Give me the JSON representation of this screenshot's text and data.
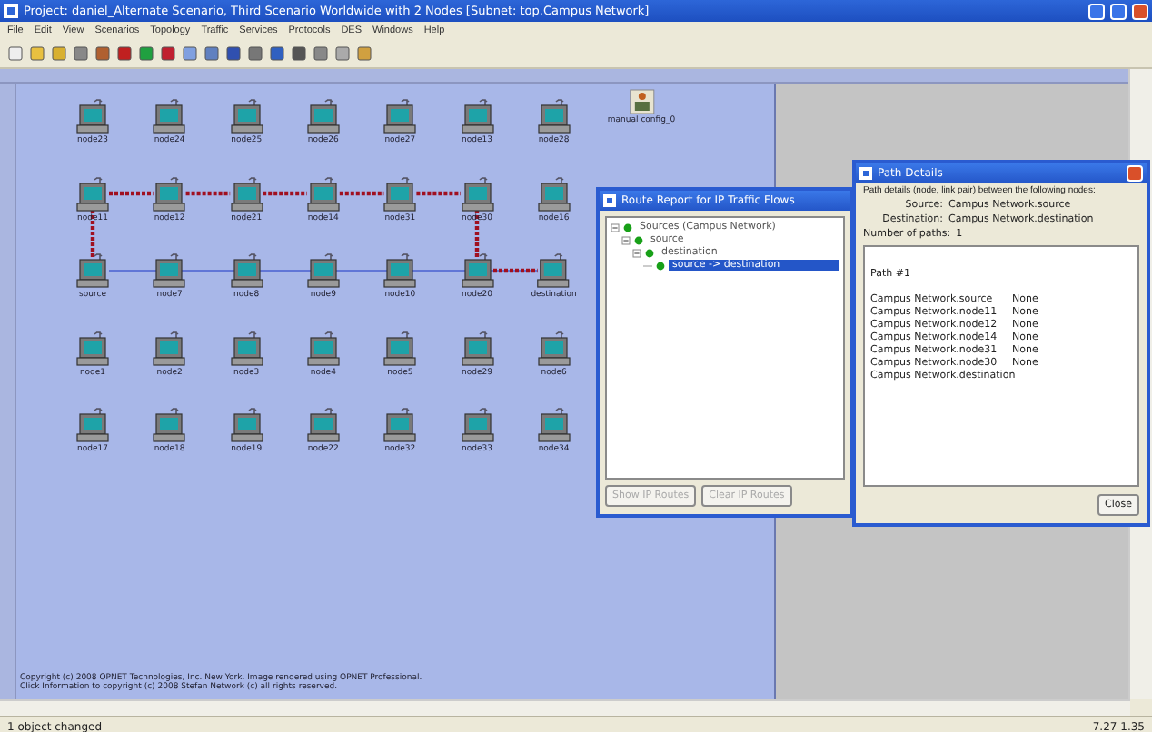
{
  "window": {
    "title": "Project: daniel_Alternate Scenario, Third Scenario Worldwide with 2 Nodes  [Subnet: top.Campus Network]"
  },
  "menu": [
    "File",
    "Edit",
    "View",
    "Scenarios",
    "Topology",
    "Traffic",
    "Services",
    "Protocols",
    "DES",
    "Windows",
    "Help"
  ],
  "canvas": {
    "config_object": {
      "label": "manual config_0"
    },
    "rows": [
      [
        {
          "label": "node23",
          "kind": "node",
          "on_route": false
        },
        {
          "label": "node24",
          "kind": "node",
          "on_route": false
        },
        {
          "label": "node25",
          "kind": "node",
          "on_route": false
        },
        {
          "label": "node26",
          "kind": "node",
          "on_route": false
        },
        {
          "label": "node27",
          "kind": "node",
          "on_route": false
        },
        {
          "label": "node13",
          "kind": "node",
          "on_route": false
        },
        {
          "label": "node28",
          "kind": "node",
          "on_route": false
        }
      ],
      [
        {
          "label": "node11",
          "kind": "node",
          "on_route": true
        },
        {
          "label": "node12",
          "kind": "node",
          "on_route": true
        },
        {
          "label": "node21",
          "kind": "node",
          "on_route": true
        },
        {
          "label": "node14",
          "kind": "node",
          "on_route": true
        },
        {
          "label": "node31",
          "kind": "node",
          "on_route": true
        },
        {
          "label": "node30",
          "kind": "node",
          "on_route": true
        },
        {
          "label": "node16",
          "kind": "node",
          "on_route": false
        }
      ],
      [
        {
          "label": "source",
          "kind": "source",
          "on_route": true
        },
        {
          "label": "node7",
          "kind": "node",
          "on_route": false
        },
        {
          "label": "node8",
          "kind": "node",
          "on_route": false
        },
        {
          "label": "node9",
          "kind": "node",
          "on_route": false
        },
        {
          "label": "node10",
          "kind": "node",
          "on_route": false
        },
        {
          "label": "node20",
          "kind": "node",
          "on_route": true
        },
        {
          "label": "destination",
          "kind": "destination",
          "on_route": true
        }
      ],
      [
        {
          "label": "node1",
          "kind": "node",
          "on_route": false
        },
        {
          "label": "node2",
          "kind": "node",
          "on_route": false
        },
        {
          "label": "node3",
          "kind": "node",
          "on_route": false
        },
        {
          "label": "node4",
          "kind": "node",
          "on_route": false
        },
        {
          "label": "node5",
          "kind": "node",
          "on_route": false
        },
        {
          "label": "node29",
          "kind": "node",
          "on_route": false
        },
        {
          "label": "node6",
          "kind": "node",
          "on_route": false
        }
      ],
      [
        {
          "label": "node17",
          "kind": "node",
          "on_route": false
        },
        {
          "label": "node18",
          "kind": "node",
          "on_route": false
        },
        {
          "label": "node19",
          "kind": "node",
          "on_route": false
        },
        {
          "label": "node22",
          "kind": "node",
          "on_route": false
        },
        {
          "label": "node32",
          "kind": "node",
          "on_route": false
        },
        {
          "label": "node33",
          "kind": "node",
          "on_route": false
        },
        {
          "label": "node34",
          "kind": "node",
          "on_route": false
        }
      ]
    ],
    "copyright": [
      "Copyright (c) 2008 OPNET Technologies, Inc. New York. Image rendered using OPNET Professional.",
      "Click Information to copyright (c) 2008 Stefan Network (c) all rights reserved."
    ]
  },
  "route_report": {
    "title": "Route Report for IP Traffic Flows",
    "tree": [
      {
        "label": "Sources (Campus Network)",
        "expanded": true,
        "selected": false,
        "children": [
          {
            "label": "source",
            "expanded": true,
            "selected": false,
            "children": [
              {
                "label": "destination",
                "expanded": true,
                "selected": false,
                "children": [
                  {
                    "label": "source -> destination",
                    "expanded": false,
                    "selected": true
                  }
                ]
              }
            ]
          }
        ]
      }
    ],
    "buttons": [
      {
        "label": "Show IP Routes",
        "disabled": true
      },
      {
        "label": "Clear IP Routes",
        "disabled": true
      }
    ]
  },
  "path_details": {
    "title": "Path Details",
    "intro": "Path details (node, link pair) between the following nodes:",
    "source_label": "Source:",
    "source": "Campus Network.source",
    "destination_label": "Destination:",
    "destination": "Campus Network.destination",
    "paths_label": "Number of paths:",
    "paths": "1",
    "path_title": "Path #1",
    "hops": [
      {
        "node": "Campus Network.source",
        "link": "None"
      },
      {
        "node": "Campus Network.node11",
        "link": "None"
      },
      {
        "node": "Campus Network.node12",
        "link": "None"
      },
      {
        "node": "Campus Network.node14",
        "link": "None"
      },
      {
        "node": "Campus Network.node31",
        "link": "None"
      },
      {
        "node": "Campus Network.node30",
        "link": "None"
      },
      {
        "node": "Campus Network.destination"
      }
    ],
    "close": "Close"
  },
  "status_bar": {
    "message": "1 object changed",
    "coords": "7.27 1.35"
  }
}
